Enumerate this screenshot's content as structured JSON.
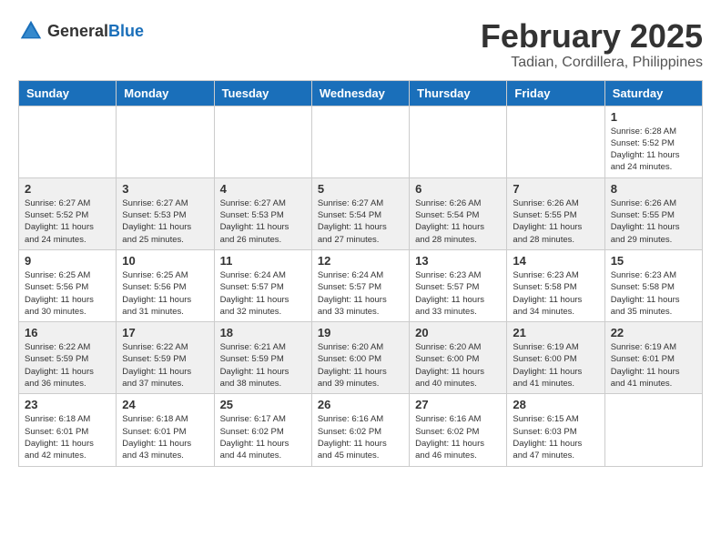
{
  "header": {
    "logo_general": "General",
    "logo_blue": "Blue",
    "month": "February 2025",
    "location": "Tadian, Cordillera, Philippines"
  },
  "weekdays": [
    "Sunday",
    "Monday",
    "Tuesday",
    "Wednesday",
    "Thursday",
    "Friday",
    "Saturday"
  ],
  "weeks": [
    [
      {
        "day": "",
        "info": ""
      },
      {
        "day": "",
        "info": ""
      },
      {
        "day": "",
        "info": ""
      },
      {
        "day": "",
        "info": ""
      },
      {
        "day": "",
        "info": ""
      },
      {
        "day": "",
        "info": ""
      },
      {
        "day": "1",
        "info": "Sunrise: 6:28 AM\nSunset: 5:52 PM\nDaylight: 11 hours and 24 minutes."
      }
    ],
    [
      {
        "day": "2",
        "info": "Sunrise: 6:27 AM\nSunset: 5:52 PM\nDaylight: 11 hours and 24 minutes."
      },
      {
        "day": "3",
        "info": "Sunrise: 6:27 AM\nSunset: 5:53 PM\nDaylight: 11 hours and 25 minutes."
      },
      {
        "day": "4",
        "info": "Sunrise: 6:27 AM\nSunset: 5:53 PM\nDaylight: 11 hours and 26 minutes."
      },
      {
        "day": "5",
        "info": "Sunrise: 6:27 AM\nSunset: 5:54 PM\nDaylight: 11 hours and 27 minutes."
      },
      {
        "day": "6",
        "info": "Sunrise: 6:26 AM\nSunset: 5:54 PM\nDaylight: 11 hours and 28 minutes."
      },
      {
        "day": "7",
        "info": "Sunrise: 6:26 AM\nSunset: 5:55 PM\nDaylight: 11 hours and 28 minutes."
      },
      {
        "day": "8",
        "info": "Sunrise: 6:26 AM\nSunset: 5:55 PM\nDaylight: 11 hours and 29 minutes."
      }
    ],
    [
      {
        "day": "9",
        "info": "Sunrise: 6:25 AM\nSunset: 5:56 PM\nDaylight: 11 hours and 30 minutes."
      },
      {
        "day": "10",
        "info": "Sunrise: 6:25 AM\nSunset: 5:56 PM\nDaylight: 11 hours and 31 minutes."
      },
      {
        "day": "11",
        "info": "Sunrise: 6:24 AM\nSunset: 5:57 PM\nDaylight: 11 hours and 32 minutes."
      },
      {
        "day": "12",
        "info": "Sunrise: 6:24 AM\nSunset: 5:57 PM\nDaylight: 11 hours and 33 minutes."
      },
      {
        "day": "13",
        "info": "Sunrise: 6:23 AM\nSunset: 5:57 PM\nDaylight: 11 hours and 33 minutes."
      },
      {
        "day": "14",
        "info": "Sunrise: 6:23 AM\nSunset: 5:58 PM\nDaylight: 11 hours and 34 minutes."
      },
      {
        "day": "15",
        "info": "Sunrise: 6:23 AM\nSunset: 5:58 PM\nDaylight: 11 hours and 35 minutes."
      }
    ],
    [
      {
        "day": "16",
        "info": "Sunrise: 6:22 AM\nSunset: 5:59 PM\nDaylight: 11 hours and 36 minutes."
      },
      {
        "day": "17",
        "info": "Sunrise: 6:22 AM\nSunset: 5:59 PM\nDaylight: 11 hours and 37 minutes."
      },
      {
        "day": "18",
        "info": "Sunrise: 6:21 AM\nSunset: 5:59 PM\nDaylight: 11 hours and 38 minutes."
      },
      {
        "day": "19",
        "info": "Sunrise: 6:20 AM\nSunset: 6:00 PM\nDaylight: 11 hours and 39 minutes."
      },
      {
        "day": "20",
        "info": "Sunrise: 6:20 AM\nSunset: 6:00 PM\nDaylight: 11 hours and 40 minutes."
      },
      {
        "day": "21",
        "info": "Sunrise: 6:19 AM\nSunset: 6:00 PM\nDaylight: 11 hours and 41 minutes."
      },
      {
        "day": "22",
        "info": "Sunrise: 6:19 AM\nSunset: 6:01 PM\nDaylight: 11 hours and 41 minutes."
      }
    ],
    [
      {
        "day": "23",
        "info": "Sunrise: 6:18 AM\nSunset: 6:01 PM\nDaylight: 11 hours and 42 minutes."
      },
      {
        "day": "24",
        "info": "Sunrise: 6:18 AM\nSunset: 6:01 PM\nDaylight: 11 hours and 43 minutes."
      },
      {
        "day": "25",
        "info": "Sunrise: 6:17 AM\nSunset: 6:02 PM\nDaylight: 11 hours and 44 minutes."
      },
      {
        "day": "26",
        "info": "Sunrise: 6:16 AM\nSunset: 6:02 PM\nDaylight: 11 hours and 45 minutes."
      },
      {
        "day": "27",
        "info": "Sunrise: 6:16 AM\nSunset: 6:02 PM\nDaylight: 11 hours and 46 minutes."
      },
      {
        "day": "28",
        "info": "Sunrise: 6:15 AM\nSunset: 6:03 PM\nDaylight: 11 hours and 47 minutes."
      },
      {
        "day": "",
        "info": ""
      }
    ]
  ]
}
